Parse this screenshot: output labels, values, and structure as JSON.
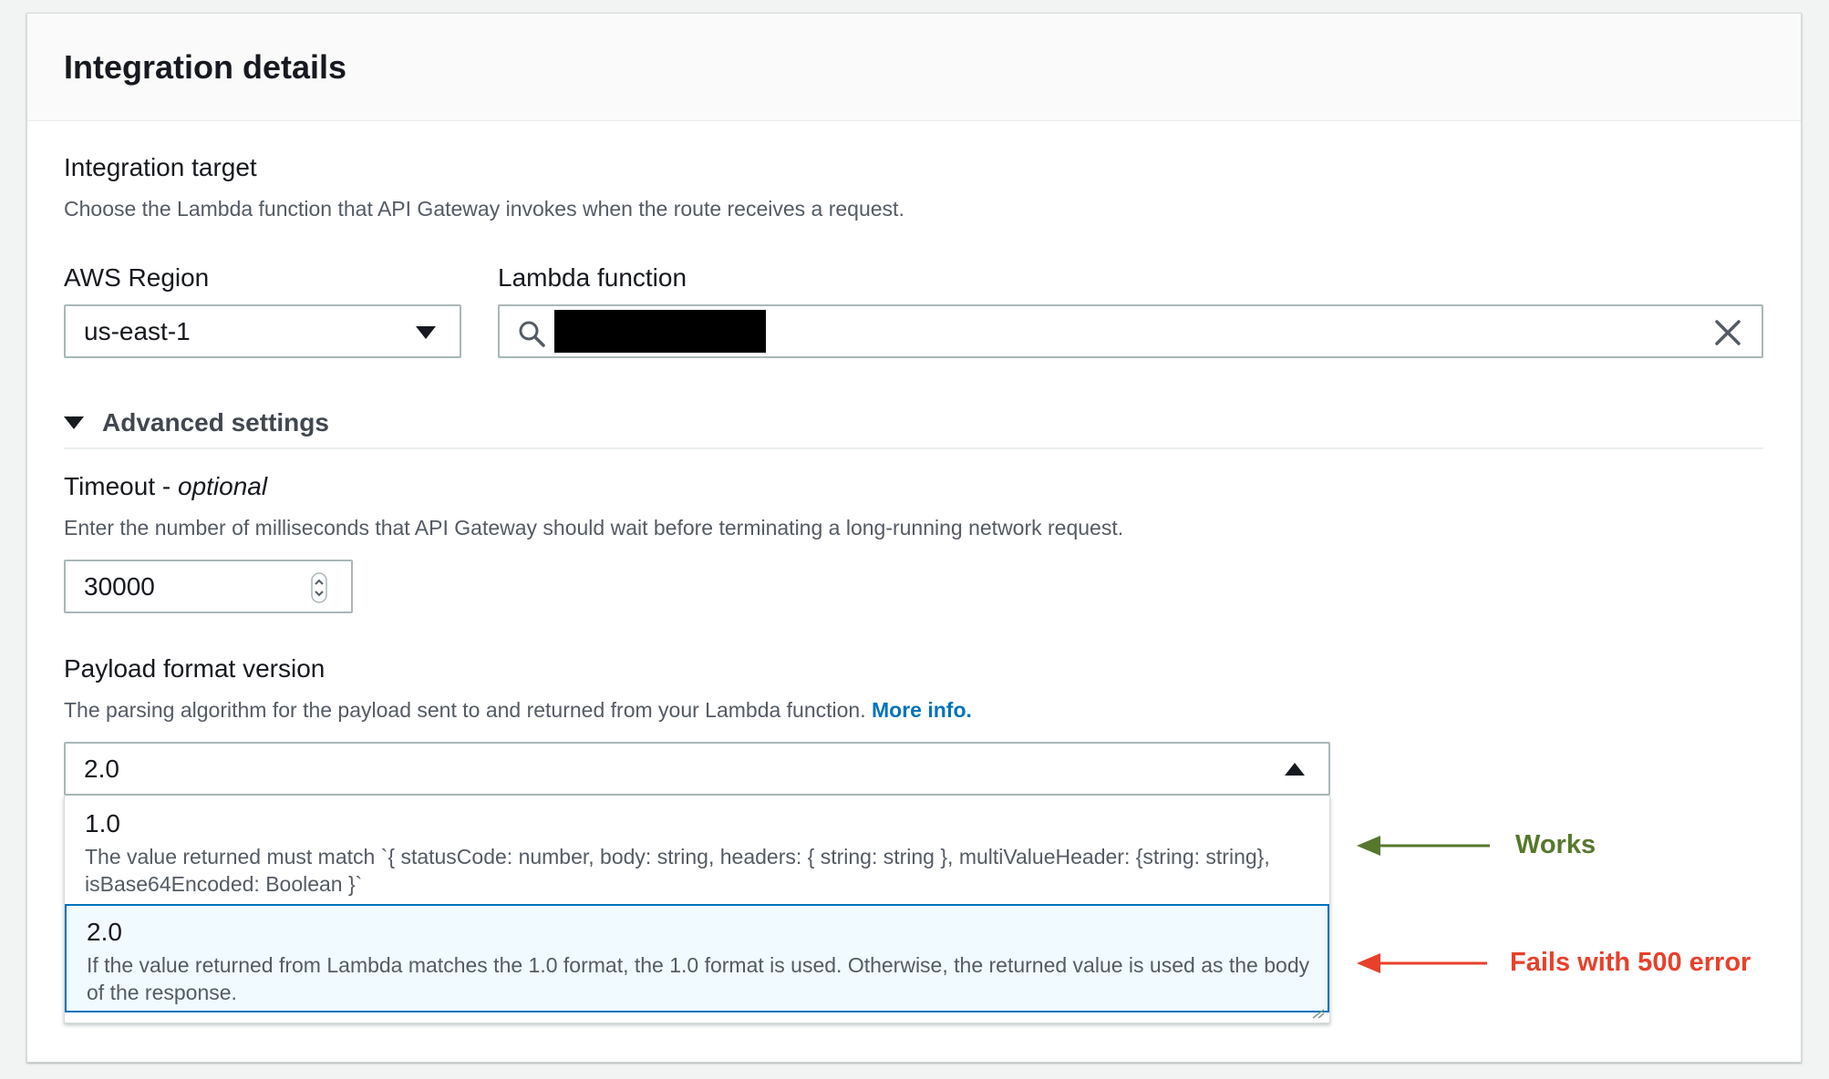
{
  "panel": {
    "title": "Integration details"
  },
  "integration_target": {
    "label": "Integration target",
    "description": "Choose the Lambda function that API Gateway invokes when the route receives a request."
  },
  "region": {
    "label": "AWS Region",
    "value": "us-east-1"
  },
  "lambda": {
    "label": "Lambda function",
    "value": ""
  },
  "advanced": {
    "label": "Advanced settings"
  },
  "timeout": {
    "label": "Timeout - ",
    "label_optional": "optional",
    "description": "Enter the number of milliseconds that API Gateway should wait before terminating a long-running network request.",
    "value": "30000"
  },
  "payload": {
    "label": "Payload format version",
    "description": "The parsing algorithm for the payload sent to and returned from your Lambda function. ",
    "more_info": "More info.",
    "selected": "2.0",
    "options": [
      {
        "title": "1.0",
        "description": "The value returned must match `{ statusCode: number, body: string, headers: { string: string }, multiValueHeader: {string: string}, isBase64Encoded: Boolean }`"
      },
      {
        "title": "2.0",
        "description": "If the value returned from Lambda matches the 1.0 format, the 1.0 format is used. Otherwise, the returned value is used as the body of the response."
      }
    ]
  },
  "annotations": {
    "works": "Works",
    "works_color": "#56782c",
    "fails": "Fails with 500 error",
    "fails_color": "#e8402b"
  },
  "icons": {
    "region_dropdown": "caret-down-icon",
    "lambda_search": "search-icon",
    "lambda_clear": "close-icon",
    "advanced_toggle": "caret-down-icon",
    "timeout_stepper": "stepper-icon",
    "payload_dropdown": "caret-up-icon"
  }
}
